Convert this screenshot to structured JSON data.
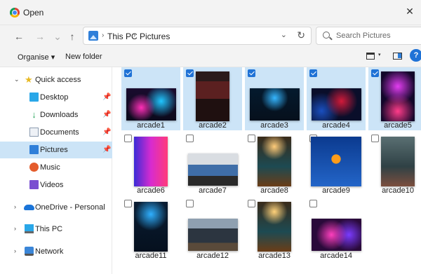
{
  "window": {
    "title": "Open",
    "close_glyph": "✕"
  },
  "nav": {
    "back_glyph": "←",
    "forward_glyph": "→",
    "up_glyph": "↑",
    "breadcrumb": [
      "This PC",
      "Pictures"
    ],
    "refresh_glyph": "↻",
    "dropdown_glyph": "⌄"
  },
  "search": {
    "placeholder": "Search Pictures"
  },
  "toolbar": {
    "organise_label": "Organise ▾",
    "new_folder_label": "New folder",
    "help_glyph": "?"
  },
  "sidebar": {
    "items": [
      {
        "label": "Quick access",
        "icon": "star-icon"
      },
      {
        "label": "Desktop",
        "icon": "desktop-icon",
        "pinned": true
      },
      {
        "label": "Downloads",
        "icon": "downloads-icon",
        "pinned": true
      },
      {
        "label": "Documents",
        "icon": "documents-icon",
        "pinned": true
      },
      {
        "label": "Pictures",
        "icon": "pictures-icon",
        "pinned": true,
        "selected": true
      },
      {
        "label": "Music",
        "icon": "music-icon"
      },
      {
        "label": "Videos",
        "icon": "videos-icon"
      },
      {
        "label": "OneDrive - Personal",
        "icon": "onedrive-icon"
      },
      {
        "label": "This PC",
        "icon": "this-pc-icon"
      },
      {
        "label": "Network",
        "icon": "network-icon"
      }
    ]
  },
  "files": [
    {
      "name": "arcade1",
      "selected": true
    },
    {
      "name": "arcade2",
      "selected": true
    },
    {
      "name": "arcade3",
      "selected": true
    },
    {
      "name": "arcade4",
      "selected": true
    },
    {
      "name": "arcade5",
      "selected": true
    },
    {
      "name": "arcade6",
      "selected": false
    },
    {
      "name": "arcade7",
      "selected": false
    },
    {
      "name": "arcade8",
      "selected": false
    },
    {
      "name": "arcade9",
      "selected": false
    },
    {
      "name": "arcade10",
      "selected": false
    },
    {
      "name": "arcade11",
      "selected": false
    },
    {
      "name": "arcade12",
      "selected": false
    },
    {
      "name": "arcade13",
      "selected": false
    },
    {
      "name": "arcade14",
      "selected": false
    }
  ],
  "colors": {
    "selection": "#cce4f7",
    "accent": "#1f72d6"
  }
}
